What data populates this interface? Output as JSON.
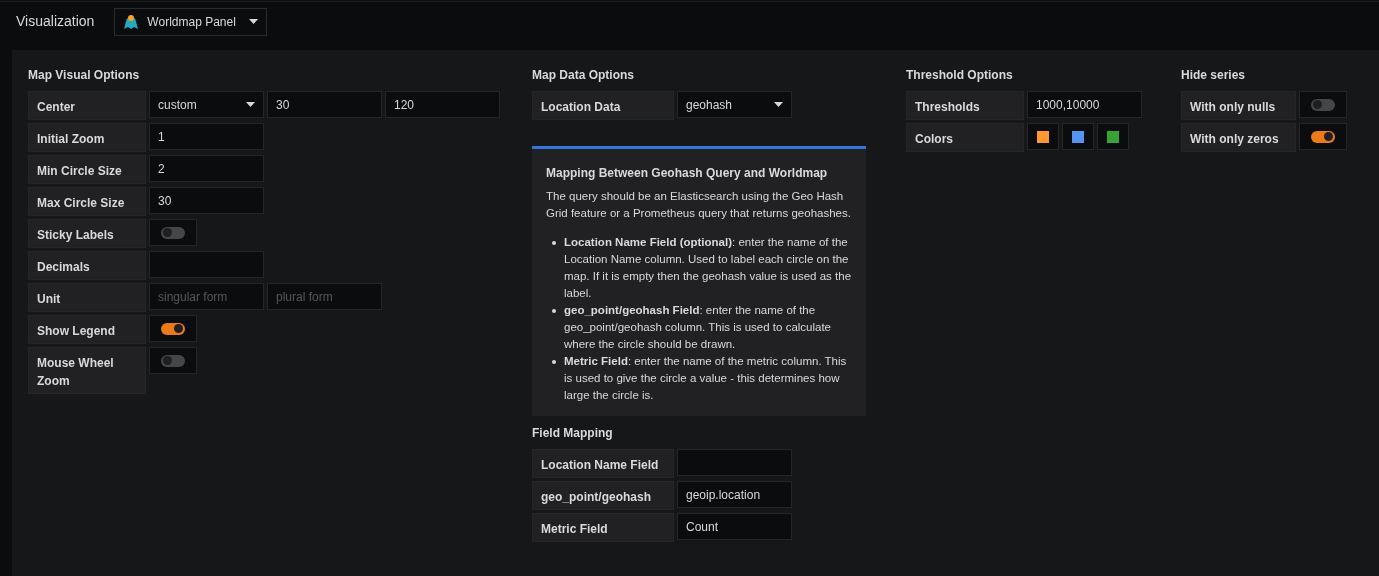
{
  "header": {
    "title": "Visualization",
    "panel_select": {
      "value": "Worldmap Panel"
    }
  },
  "map_visual_options": {
    "title": "Map Visual Options",
    "rows": [
      {
        "label": "Center",
        "controls": [
          {
            "kind": "select",
            "value": "custom"
          },
          {
            "kind": "input",
            "value": "30"
          },
          {
            "kind": "input",
            "value": "120"
          }
        ]
      },
      {
        "label": "Initial Zoom",
        "controls": [
          {
            "kind": "input",
            "value": "1"
          }
        ]
      },
      {
        "label": "Min Circle Size",
        "controls": [
          {
            "kind": "input",
            "value": "2"
          }
        ]
      },
      {
        "label": "Max Circle Size",
        "controls": [
          {
            "kind": "input",
            "value": "30"
          }
        ]
      },
      {
        "label": "Sticky Labels",
        "controls": [
          {
            "kind": "switch",
            "on": false
          }
        ]
      },
      {
        "label": "Decimals",
        "controls": [
          {
            "kind": "input"
          }
        ]
      },
      {
        "label": "Unit",
        "controls": [
          {
            "kind": "input",
            "placeholder": "singular form"
          },
          {
            "kind": "input",
            "placeholder": "plural form"
          }
        ]
      },
      {
        "label": "Show Legend",
        "controls": [
          {
            "kind": "switch",
            "on": true
          }
        ]
      },
      {
        "label": "Mouse Wheel Zoom",
        "controls": [
          {
            "kind": "switch",
            "on": false
          }
        ]
      }
    ]
  },
  "map_data_options": {
    "title": "Map Data Options",
    "rows": [
      {
        "label": "Location Data",
        "controls": [
          {
            "kind": "select",
            "value": "geohash"
          }
        ]
      }
    ]
  },
  "help": {
    "title": "Mapping Between Geohash Query and Worldmap",
    "intro": "The query should be an Elasticsearch using the Geo Hash Grid feature or a Prometheus query that returns geohashes.",
    "bullets": [
      "**Location Name Field (optional)**: enter the name of the Location Name column. Used to label each circle on the map. If it is empty then the geohash value is used as the label.",
      "**geo_point/geohash Field**: enter the name of the geo_point/geohash column. This is used to calculate where the circle should be drawn.",
      "**Metric Field**: enter the name of the metric column. This is used to give the circle a value - this determines how large the circle is."
    ]
  },
  "field_mapping": {
    "title": "Field Mapping",
    "rows": [
      {
        "label": "Location Name Field",
        "controls": [
          {
            "kind": "input"
          }
        ]
      },
      {
        "label": "geo_point/geohash",
        "controls": [
          {
            "kind": "input",
            "value": "geoip.location"
          }
        ]
      },
      {
        "label": "Metric Field",
        "controls": [
          {
            "kind": "input",
            "value": "Count"
          }
        ]
      }
    ]
  },
  "threshold_options": {
    "title": "Threshold Options",
    "rows": [
      {
        "label": "Thresholds",
        "controls": [
          {
            "kind": "input",
            "value": "1000,10000"
          }
        ]
      },
      {
        "label": "Colors",
        "controls": [
          {
            "kind": "color",
            "color": "#ff9830"
          },
          {
            "kind": "color",
            "color": "#5794f2"
          },
          {
            "kind": "color",
            "color": "#37a336"
          }
        ]
      }
    ]
  },
  "hide_series": {
    "title": "Hide series",
    "rows": [
      {
        "label": "With only nulls",
        "controls": [
          {
            "kind": "switch",
            "on": false
          }
        ]
      },
      {
        "label": "With only zeros",
        "controls": [
          {
            "kind": "switch",
            "on": true
          }
        ]
      }
    ]
  }
}
